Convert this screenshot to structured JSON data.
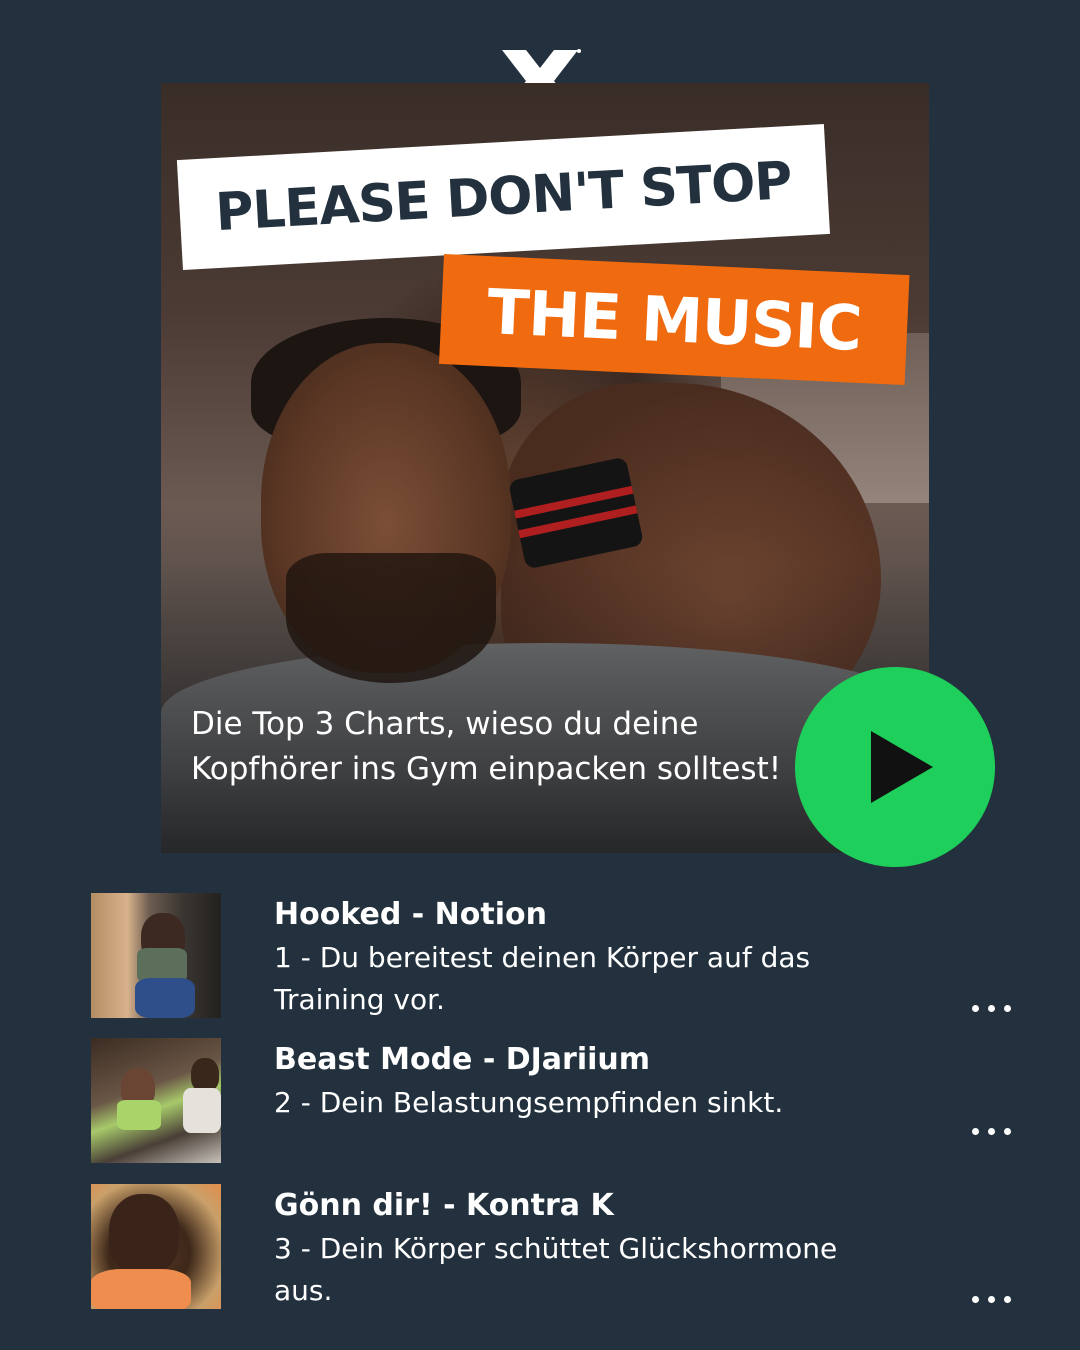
{
  "brand": {
    "logo_icon": "x-logo-icon",
    "accent_green": "#1ed05b",
    "accent_orange": "#f06b10",
    "background": "#22313d"
  },
  "hero": {
    "headline_line1": "PLEASE DON'T STOP",
    "headline_line2": "THE MUSIC",
    "caption": "Die Top 3 Charts, wieso du deine Kopfhörer ins Gym einpacken solltest!",
    "play_icon": "play-icon"
  },
  "tracks": [
    {
      "title": "Hooked - Notion",
      "description": "1 - Du bereitest deinen Körper auf das Training vor.",
      "menu_icon": "more-options-icon"
    },
    {
      "title": "Beast Mode - DJariium",
      "description": "2 - Dein Belastungsempfinden sinkt.",
      "menu_icon": "more-options-icon"
    },
    {
      "title": "Gönn dir! - Kontra K",
      "description": "3 - Dein Körper schüttet Glückshormone aus.",
      "menu_icon": "more-options-icon"
    }
  ]
}
